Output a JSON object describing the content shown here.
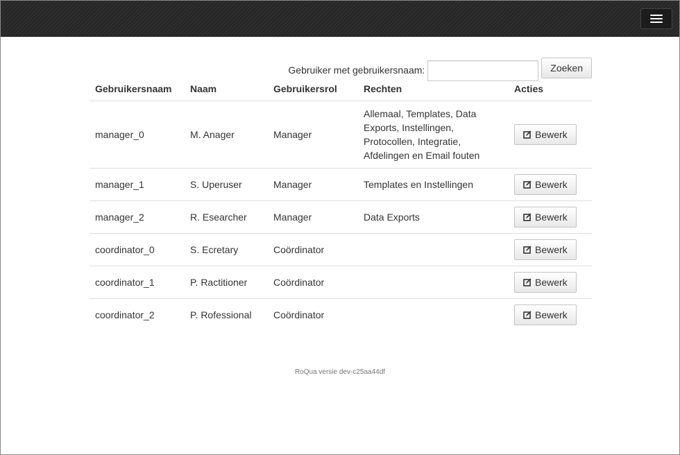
{
  "navbar": {
    "menu_icon": "hamburger-icon"
  },
  "search": {
    "label": "Gebruiker met gebruikersnaam:",
    "value": "",
    "placeholder": "",
    "button_label": "Zoeken"
  },
  "table": {
    "headers": {
      "username": "Gebruikersnaam",
      "name": "Naam",
      "role": "Gebruikersrol",
      "rights": "Rechten",
      "actions": "Acties"
    },
    "rows": [
      {
        "username": "manager_0",
        "name": "M. Anager",
        "role": "Manager",
        "rights": "Allemaal, Templates, Data Exports, Instellingen, Protocollen, Integratie, Afdelingen en Email fouten",
        "action": "Bewerk"
      },
      {
        "username": "manager_1",
        "name": "S. Uperuser",
        "role": "Manager",
        "rights": "Templates en Instellingen",
        "action": "Bewerk"
      },
      {
        "username": "manager_2",
        "name": "R. Esearcher",
        "role": "Manager",
        "rights": "Data Exports",
        "action": "Bewerk"
      },
      {
        "username": "coordinator_0",
        "name": "S. Ecretary",
        "role": "Coördinator",
        "rights": "",
        "action": "Bewerk"
      },
      {
        "username": "coordinator_1",
        "name": "P. Ractitioner",
        "role": "Coördinator",
        "rights": "",
        "action": "Bewerk"
      },
      {
        "username": "coordinator_2",
        "name": "P. Rofessional",
        "role": "Coördinator",
        "rights": "",
        "action": "Bewerk"
      }
    ]
  },
  "icons": {
    "edit": "edit-icon"
  },
  "footer": {
    "version_text": "RoQua versie dev-c25aa44df"
  }
}
